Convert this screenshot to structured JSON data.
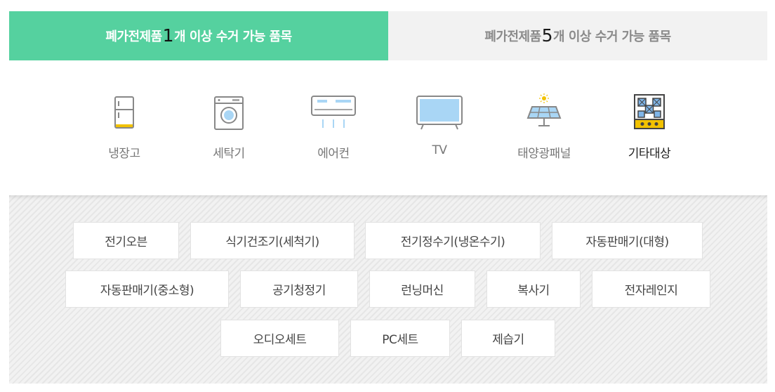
{
  "tabs": [
    {
      "prefix": "폐가전제품 ",
      "num": "1",
      "suffix": "개 이상 수거 가능 품목"
    },
    {
      "prefix": "폐가전제품 ",
      "num": "5",
      "suffix": "개 이상 수거 가능 품목"
    }
  ],
  "categories": [
    {
      "label": "냉장고",
      "icon": "refrigerator-icon"
    },
    {
      "label": "세탁기",
      "icon": "washing-machine-icon"
    },
    {
      "label": "에어컨",
      "icon": "air-conditioner-icon"
    },
    {
      "label": "TV",
      "icon": "tv-icon"
    },
    {
      "label": "태양광패널",
      "icon": "solar-panel-icon"
    },
    {
      "label": "기타대상",
      "icon": "stove-icon"
    }
  ],
  "items": [
    {
      "label": "전기오븐"
    },
    {
      "label": "식기건조기(세척기)"
    },
    {
      "label": "전기정수기(냉온수기)"
    },
    {
      "label": "자동판매기(대형)"
    },
    {
      "label": "자동판매기(중소형)"
    },
    {
      "label": "공기청정기"
    },
    {
      "label": "런닝머신"
    },
    {
      "label": "복사기"
    },
    {
      "label": "전자레인지"
    },
    {
      "label": "오디오세트"
    },
    {
      "label": "PC세트"
    },
    {
      "label": "제습기"
    }
  ],
  "colors": {
    "accent": "#55d19f",
    "inactive_tab": "#f2f2f2"
  }
}
